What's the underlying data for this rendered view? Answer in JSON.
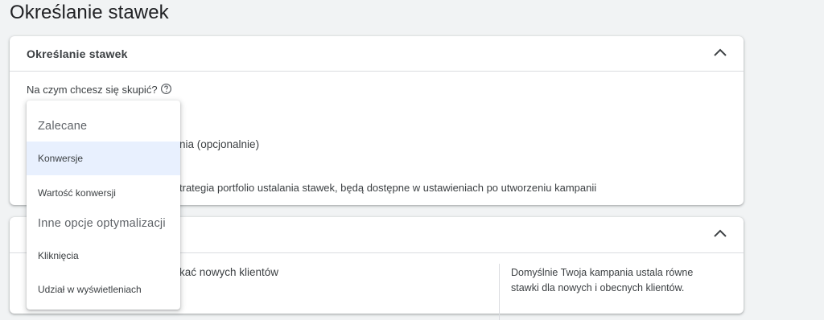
{
  "page": {
    "title": "Określanie stawek"
  },
  "bidding_card": {
    "title": "Określanie stawek",
    "question": "Na czym chcesz się skupić?",
    "optional_partial": "nia (opcjonalnie)",
    "portfolio_partial": "trategia portfolio ustalania stawek, będą dostępne w ustawieniach po utworzeniu kampanii"
  },
  "second_card": {
    "text_partial": "kać nowych klientów",
    "side_note_lines": [
      "Domyślnie Twoja kampania ustala równe",
      "stawki dla nowych i obecnych klientów."
    ]
  },
  "dropdown": {
    "group_recommended": "Zalecane",
    "group_other": "Inne opcje optymalizacji",
    "items": [
      {
        "label": "Konwersje",
        "selected": true
      },
      {
        "label": "Wartość konwersji",
        "selected": false
      },
      {
        "label": "Kliknięcia",
        "selected": false
      },
      {
        "label": "Udział w wyświetleniach",
        "selected": false
      }
    ]
  },
  "icons": {
    "collapse": "chevron-up-icon",
    "help": "help-circle-icon"
  },
  "colors": {
    "background": "#f1f3f4",
    "card": "#ffffff",
    "selected_item": "#e8f0fe",
    "divider": "#dadce0",
    "text": "#3c4043"
  }
}
